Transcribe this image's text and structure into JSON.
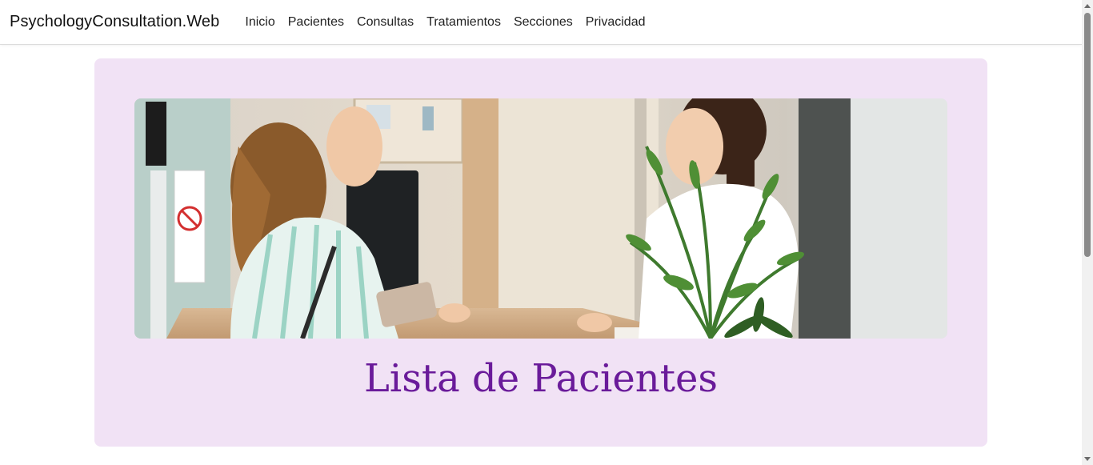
{
  "navbar": {
    "brand": "PsychologyConsultation.Web",
    "links": [
      {
        "label": "Inicio"
      },
      {
        "label": "Pacientes"
      },
      {
        "label": "Consultas"
      },
      {
        "label": "Tratamientos"
      },
      {
        "label": "Secciones"
      },
      {
        "label": "Privacidad"
      }
    ]
  },
  "hero": {
    "title": "Lista de Pacientes",
    "image_icon": "reception-photo"
  },
  "colors": {
    "card_background": "#f1e2f5",
    "title": "#6a1b9a"
  }
}
